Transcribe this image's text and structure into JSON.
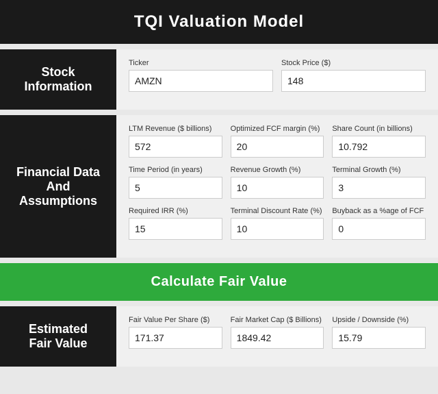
{
  "header": {
    "title": "TQI Valuation Model"
  },
  "stock_section": {
    "label": "Stock\nInformation",
    "fields": [
      {
        "id": "ticker",
        "label": "Ticker",
        "value": "AMZN"
      },
      {
        "id": "stock_price",
        "label": "Stock Price ($)",
        "value": "148"
      }
    ]
  },
  "financial_section": {
    "label": "Financial Data\nAnd\nAssumptions",
    "row1": [
      {
        "id": "ltm_revenue",
        "label": "LTM Revenue ($ billions)",
        "value": "572"
      },
      {
        "id": "fcf_margin",
        "label": "Optimized FCF margin (%)",
        "value": "20"
      },
      {
        "id": "share_count",
        "label": "Share Count (in billions)",
        "value": "10.792"
      }
    ],
    "row2": [
      {
        "id": "time_period",
        "label": "Time Period (in years)",
        "value": "5"
      },
      {
        "id": "revenue_growth",
        "label": "Revenue Growth (%)",
        "value": "10"
      },
      {
        "id": "terminal_growth",
        "label": "Terminal Growth (%)",
        "value": "3"
      }
    ],
    "row3": [
      {
        "id": "required_irr",
        "label": "Required IRR (%)",
        "value": "15"
      },
      {
        "id": "terminal_discount",
        "label": "Terminal Discount Rate (%)",
        "value": "10"
      },
      {
        "id": "buyback",
        "label": "Buyback as a %age of FCF",
        "value": "0"
      }
    ]
  },
  "calculate_button": {
    "label": "Calculate Fair Value"
  },
  "results_section": {
    "label": "Estimated\nFair Value",
    "fields": [
      {
        "id": "fair_value_per_share",
        "label": "Fair Value Per Share ($)",
        "value": "171.37"
      },
      {
        "id": "fair_market_cap",
        "label": "Fair Market Cap ($ Billions)",
        "value": "1849.42"
      },
      {
        "id": "upside_downside",
        "label": "Upside / Downside (%)",
        "value": "15.79"
      }
    ]
  }
}
